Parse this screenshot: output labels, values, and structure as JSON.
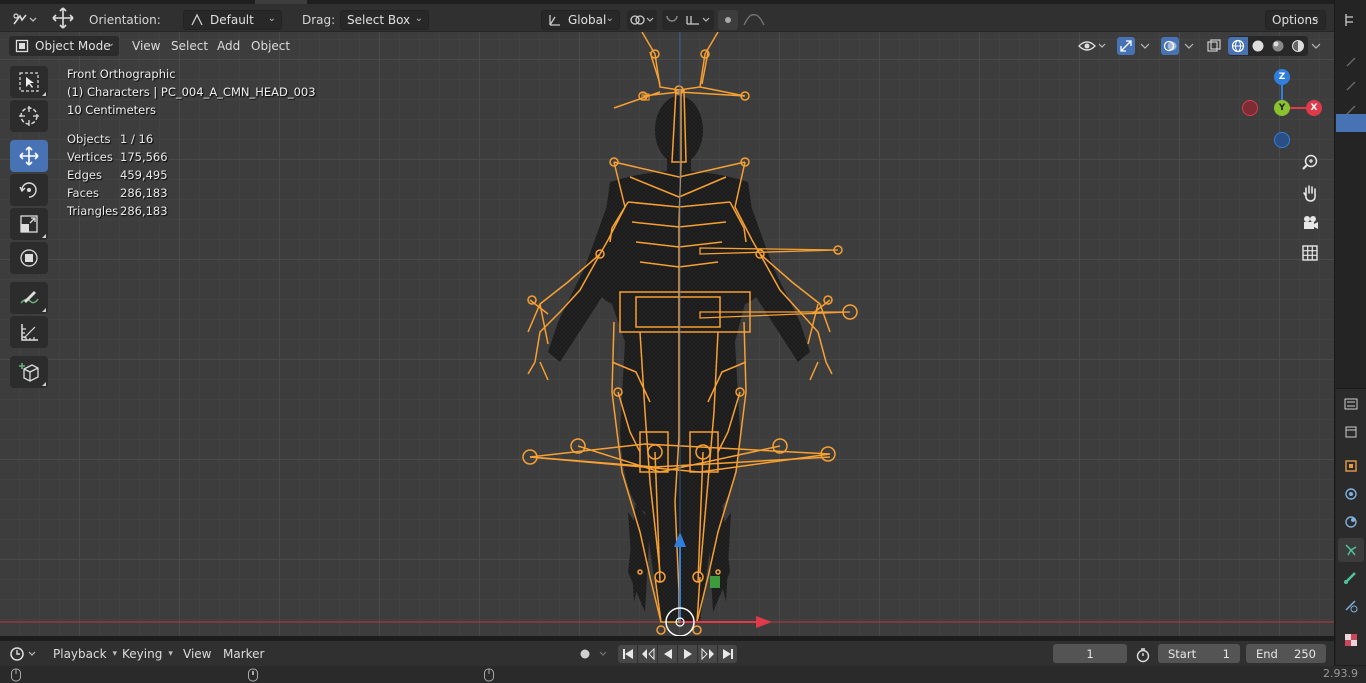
{
  "tool_header": {
    "orientation_label": "Orientation:",
    "orientation_value": "Default",
    "drag_label": "Drag:",
    "drag_value": "Select Box",
    "transform_space": "Global",
    "options_label": "Options"
  },
  "viewport_header": {
    "mode": "Object Mode",
    "menu": [
      "View",
      "Select",
      "Add",
      "Object"
    ]
  },
  "overlay": {
    "view_name": "Front Orthographic",
    "active_object": "(1) Characters | PC_004_A_CMN_HEAD_003",
    "grid_scale": "10 Centimeters",
    "stats": [
      {
        "label": "Objects",
        "value": "1 / 16"
      },
      {
        "label": "Vertices",
        "value": "175,566"
      },
      {
        "label": "Edges",
        "value": "459,495"
      },
      {
        "label": "Faces",
        "value": "286,183"
      },
      {
        "label": "Triangles",
        "value": "286,183"
      }
    ]
  },
  "gizmo": {
    "z": "Z",
    "y": "Y",
    "x": "X"
  },
  "timeline": {
    "menu": [
      "Playback",
      "Keying",
      "View",
      "Marker"
    ],
    "current_frame": "1",
    "start_label": "Start",
    "start_value": "1",
    "end_label": "End",
    "end_value": "250"
  },
  "status": {
    "version": "2.93.9"
  },
  "colors": {
    "accent": "#4772b3",
    "bone": "#f7a033",
    "axis_x": "#e03a4a",
    "axis_y": "#8ac12f",
    "axis_z": "#2f7fe0"
  },
  "icons": {
    "toolbar": [
      "select-box-icon",
      "cursor-icon",
      "move-icon",
      "rotate-icon",
      "scale-icon",
      "transform-icon",
      "annotate-icon",
      "measure-icon",
      "add-cube-icon"
    ],
    "nav": [
      "zoom-icon",
      "hand-pan-icon",
      "camera-icon",
      "grid-icon"
    ]
  }
}
